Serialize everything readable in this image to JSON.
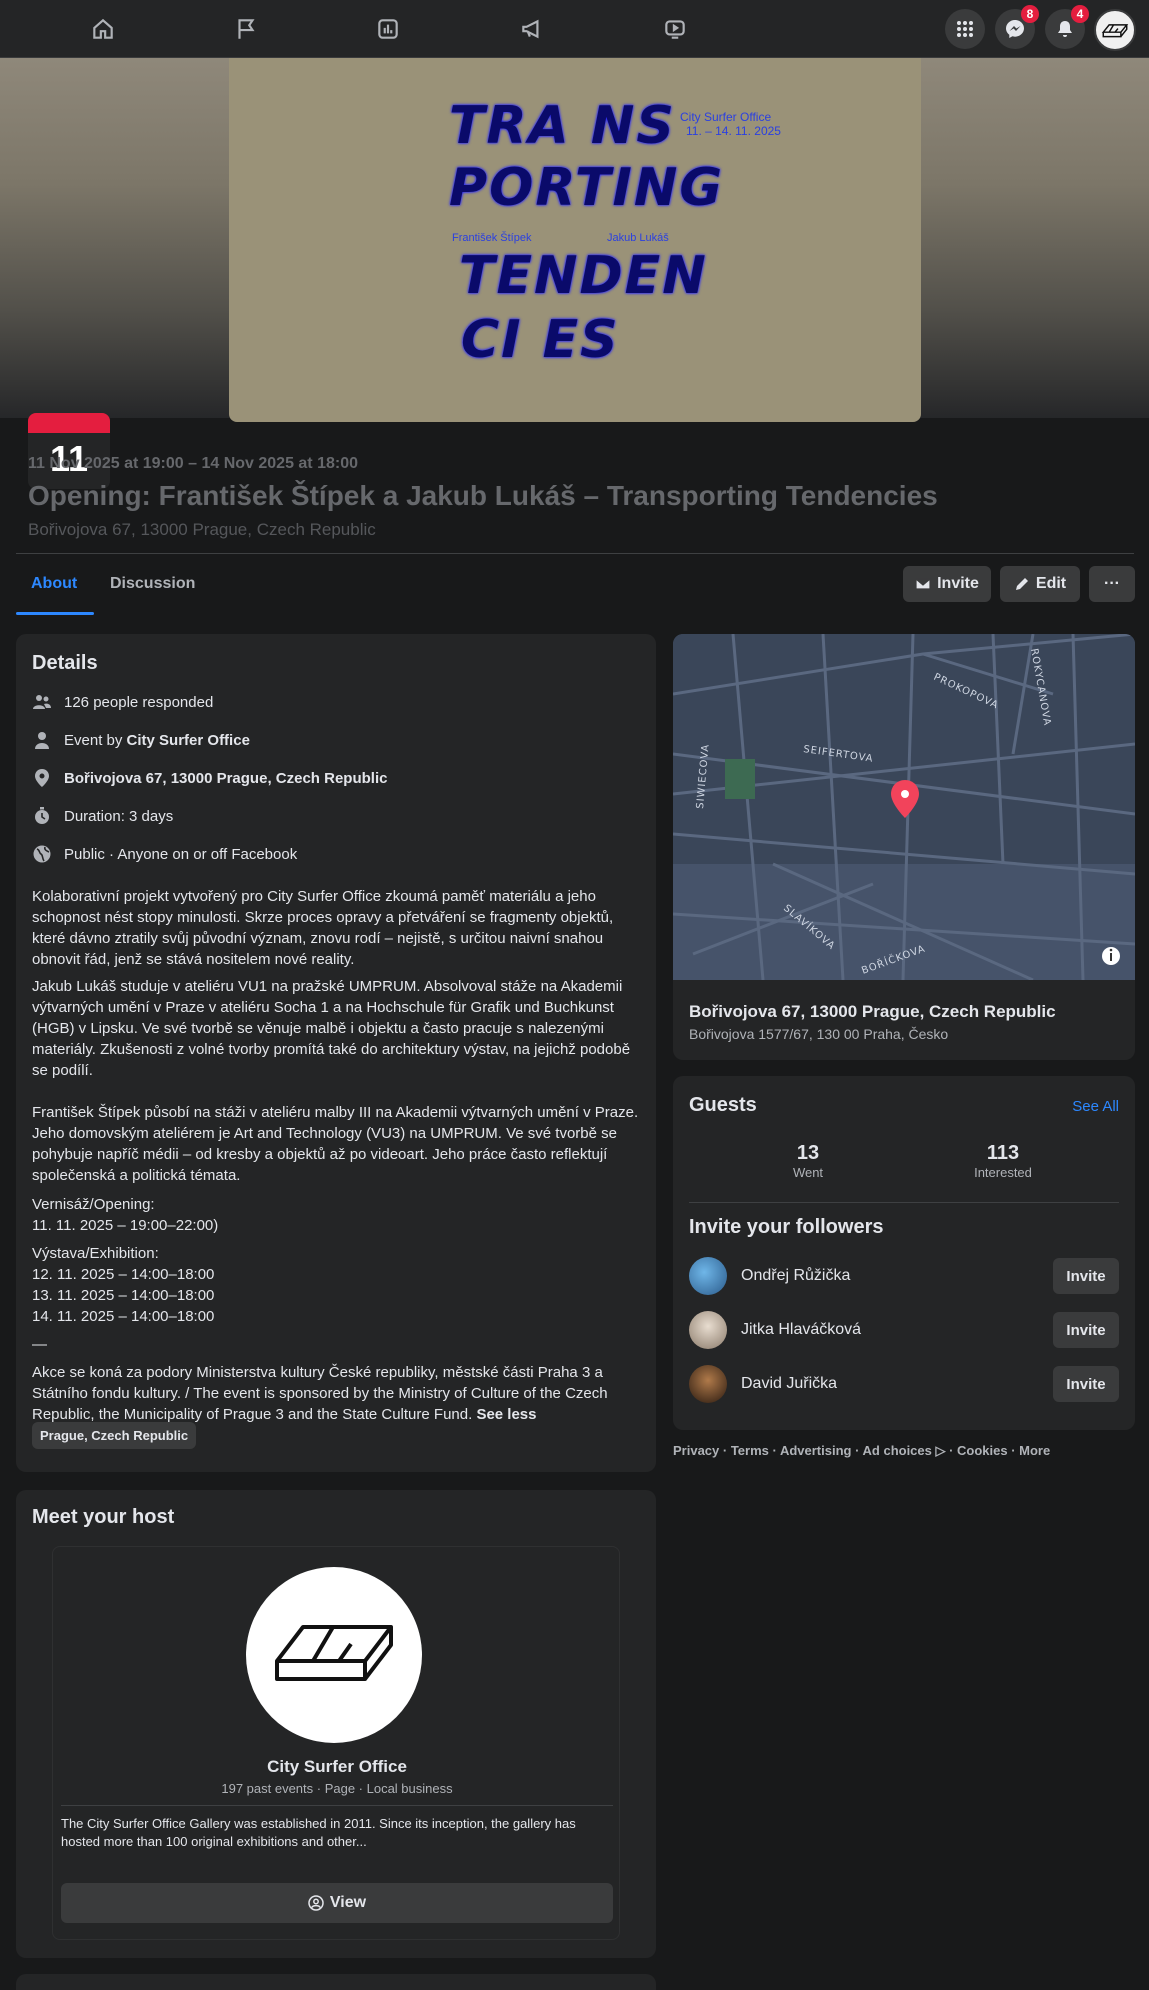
{
  "nav": {
    "messenger_badge": "8",
    "notifications_badge": "4"
  },
  "cover": {
    "poster_line1": "TRA NS",
    "poster_line2": "PORTING",
    "poster_line3": "TENDEN",
    "poster_line4": "CI ES",
    "poster_venue": "City Surfer Office",
    "poster_dates": "11. – 14. 11. 2025",
    "poster_artist1": "František Štípek",
    "poster_artist2": "Jakub Lukáš",
    "date_day": "11"
  },
  "event": {
    "date_range": "11 Nov 2025 at 19:00 – 14 Nov 2025 at 18:00",
    "title": "Opening: František Štípek a Jakub Lukáš – Transporting Tendencies",
    "address": "Bořivojova 67, 13000 Prague, Czech Republic"
  },
  "tabs": {
    "about": "About",
    "discussion": "Discussion"
  },
  "actions": {
    "invite": "Invite",
    "edit": "Edit",
    "more": "···"
  },
  "details": {
    "heading": "Details",
    "responded": "126 people responded",
    "event_by_prefix": "Event by ",
    "event_by_name": "City Surfer Office",
    "location": "Bořivojova 67, 13000 Prague, Czech Republic",
    "duration": "Duration: 3 days",
    "privacy": "Public · Anyone on or off Facebook",
    "p1": "Kolaborativní projekt vytvořený pro City Surfer Office zkoumá paměť materiálu a jeho schopnost nést stopy minulosti. Skrze proces opravy a přetváření se fragmenty objektů, které dávno ztratily svůj původní význam, znovu rodí – nejistě, s určitou naivní snahou obnovit řád, jenž se stává nositelem nové reality.",
    "p2": "Jakub Lukáš studuje v ateliéru VU1 na pražské UMPRUM. Absolvoval stáže na Akademii výtvarných umění v Praze v ateliéru Socha 1 a na Hochschule für Grafik und Buchkunst (HGB) v Lipsku. Ve své tvorbě se věnuje malbě i objektu a často pracuje s nalezenými materiály. Zkušenosti z volné tvorby promítá také do architektury výstav, na jejichž podobě se podílí.",
    "p3": "František Štípek působí na stáži v ateliéru malby III na Akademii výtvarných umění v Praze. Jeho domovským ateliérem je Art and Technology (VU3) na UMPRUM. Ve své tvorbě se pohybuje napříč médii – od kresby a objektů až po videoart. Jeho práce často reflektují společenská a politická témata.",
    "opening_label": "Vernisáž/Opening:",
    "opening_time": "11. 11. 2025 – 19:00–22:00)",
    "exhibition_label": "Výstava/Exhibition:",
    "exhibition_1": "12. 11. 2025 – 14:00–18:00",
    "exhibition_2": "13. 11. 2025 – 14:00–18:00",
    "exhibition_3": "14. 11. 2025 – 14:00–18:00",
    "dash": "—",
    "p4": "Akce se koná za podory Ministerstva kultury České republiky, městské části Praha 3 a Státního fondu kultury. / The event is sponsored by the Ministry of Culture of the Czech Republic, the Municipality of Prague 3 and the State Culture Fund.",
    "see_less": "See less",
    "chip": "Prague, Czech Republic"
  },
  "map": {
    "streets": [
      "PROKOPOVA",
      "ROKYCANOVA",
      "SEIFERTOVA",
      "SIWIECOVA",
      "SLAVÍKOVA",
      "BOŘÍČKOVA"
    ],
    "address_title": "Bořivojova 67, 13000 Prague, Czech Republic",
    "address_sub": "Bořivojova 1577/67, 130 00 Praha, Česko"
  },
  "guests": {
    "heading": "Guests",
    "see_all": "See All",
    "went_count": "13",
    "went_label": "Went",
    "interested_count": "113",
    "interested_label": "Interested",
    "invite_heading": "Invite your followers",
    "followers": [
      {
        "name": "Ondřej Růžička",
        "button": "Invite"
      },
      {
        "name": "Jitka Hlaváčková",
        "button": "Invite"
      },
      {
        "name": "David Juřička",
        "button": "Invite"
      }
    ]
  },
  "footer": "Privacy · Terms · Advertising · Ad choices ▷ · Cookies · More",
  "host": {
    "heading": "Meet your host",
    "name": "City Surfer Office",
    "meta": "197 past events · Page · Local business",
    "description": "The City Surfer Office Gallery was established in 2011. Since its inception, the gallery has hosted more than 100 original exhibitions and other...",
    "view_button": "View"
  }
}
